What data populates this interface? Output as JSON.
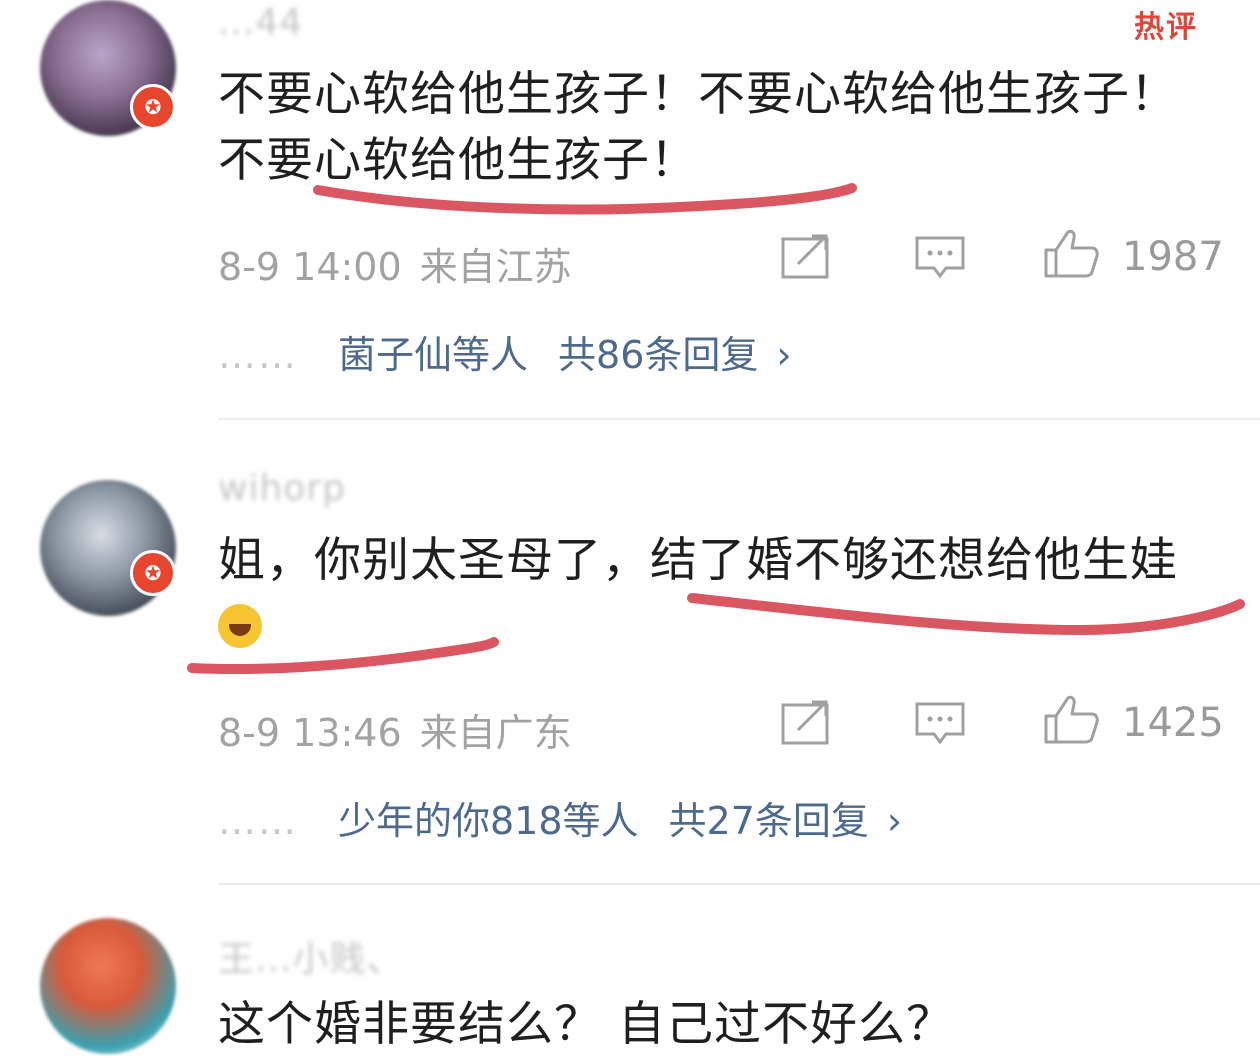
{
  "colors": {
    "accent_red": "#e0443a",
    "link_blue": "#4d6a8e",
    "meta_gray": "#a2a2a2",
    "underline_red": "#d2323f"
  },
  "comments": [
    {
      "username": "...44",
      "hot_tag": "热评",
      "text_plain": "不要心软给他生孩子！不要心软给他生孩子！",
      "text_emph": "不要心软给他生孩子！",
      "time": "8-9 14:00",
      "location": "来自江苏",
      "likes": "1987",
      "reply_people": "菌子仙等人",
      "reply_total": "共86条回复",
      "icons": [
        "share-icon",
        "comment-icon",
        "like-icon"
      ]
    },
    {
      "username": "wihorp",
      "text_plain": "姐，你别太圣母了，",
      "text_emph": "结了婚不够还想给他生娃",
      "emoji": "laugh-cry-emoji",
      "time": "8-9 13:46",
      "location": "来自广东",
      "likes": "1425",
      "reply_people": "少年的你818等人",
      "reply_total": "共27条回复",
      "icons": [
        "share-icon",
        "comment-icon",
        "like-icon"
      ]
    },
    {
      "username": "王...小贱、",
      "text_plain": "这个婚非要结么？ 自己过不好么？"
    }
  ],
  "reply_dots": "……",
  "chevron": "›"
}
